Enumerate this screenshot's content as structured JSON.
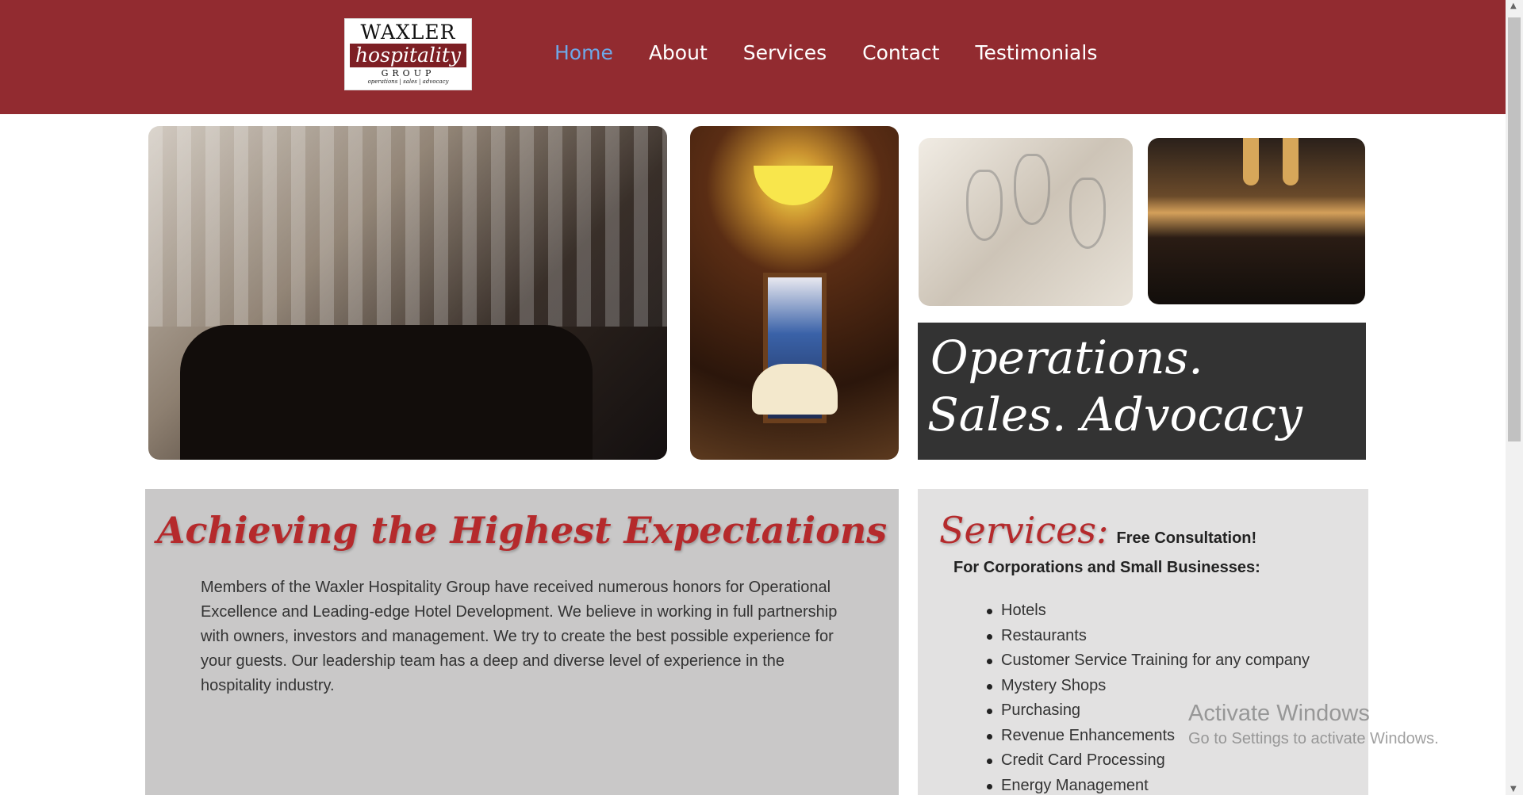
{
  "logo": {
    "line1": "WAXLER",
    "line2": "hospitality",
    "line3": "GROUP",
    "line4": "operations | sales | advocacy"
  },
  "nav": {
    "items": [
      "Home",
      "About",
      "Services",
      "Contact",
      "Testimonials"
    ],
    "active": "Home"
  },
  "tagline": {
    "line1": "Operations.",
    "line2": "Sales. Advocacy"
  },
  "intro": {
    "heading": "Achieving the Highest Expectations",
    "body": "Members of the Waxler Hospitality Group have received numerous honors for Operational Excellence and Leading-edge Hotel Development. We believe in working in full partnership with owners, investors and management. We try to create the best possible experience for your guests. Our leadership team has a deep and diverse level of experience in the hospitality industry."
  },
  "services": {
    "title": "Services:",
    "free": "Free Consultation!",
    "subtitle": "For Corporations and Small Businesses:",
    "items": [
      "Hotels",
      "Restaurants",
      "Customer Service Training for any company",
      "Mystery Shops",
      "Purchasing",
      "Revenue Enhancements",
      "Credit Card Processing",
      "Energy Management"
    ]
  },
  "watermark": {
    "title": "Activate Windows",
    "subtitle": "Go to Settings to activate Windows."
  },
  "colors": {
    "header": "#922b30",
    "accent": "#b52a2c",
    "nav_active": "#6ea8e8"
  }
}
